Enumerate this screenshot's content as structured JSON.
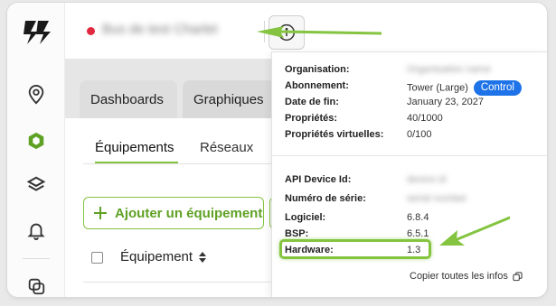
{
  "app": {
    "window_title_blurred": "Bus de test Charlet",
    "colors": {
      "accent_green": "#84c440",
      "status_red": "#e0293e",
      "badge_blue": "#1e73e8"
    }
  },
  "sidebar": {
    "items": [
      {
        "icon": "logo-icon"
      },
      {
        "icon": "location-pin-icon"
      },
      {
        "icon": "cube-icon"
      },
      {
        "icon": "layers-icon"
      },
      {
        "icon": "bell-icon"
      },
      {
        "icon": "settings-cluster-icon"
      }
    ]
  },
  "header": {
    "info_icon": "info-icon"
  },
  "tabs": [
    "Dashboards",
    "Graphiques"
  ],
  "subtabs": [
    "Équipements",
    "Réseaux"
  ],
  "actions": {
    "add_label": "Ajouter un équipement"
  },
  "table": {
    "column_equipment": "Équipement"
  },
  "info_panel": {
    "org": {
      "label": "Organisation:",
      "value": "Organisation name"
    },
    "subscription": {
      "label": "Abonnement:",
      "value": "Tower (Large)",
      "badge": "Control"
    },
    "end_date": {
      "label": "Date de fin:",
      "value": "January 23, 2027"
    },
    "properties": {
      "label": "Propriétés:",
      "value": "40/1000"
    },
    "virtual_properties": {
      "label": "Propriétés virtuelles:",
      "value": "0/100"
    },
    "api_device_id": {
      "label": "API Device Id:",
      "value": "device id"
    },
    "serial": {
      "label": "Numéro de série:",
      "value": "serial number"
    },
    "software": {
      "label": "Logiciel:",
      "value": "6.8.4"
    },
    "bsp": {
      "label": "BSP:",
      "value": "6.5.1"
    },
    "hardware": {
      "label": "Hardware:",
      "value": "1.3"
    },
    "copy_label": "Copier toutes les infos"
  }
}
